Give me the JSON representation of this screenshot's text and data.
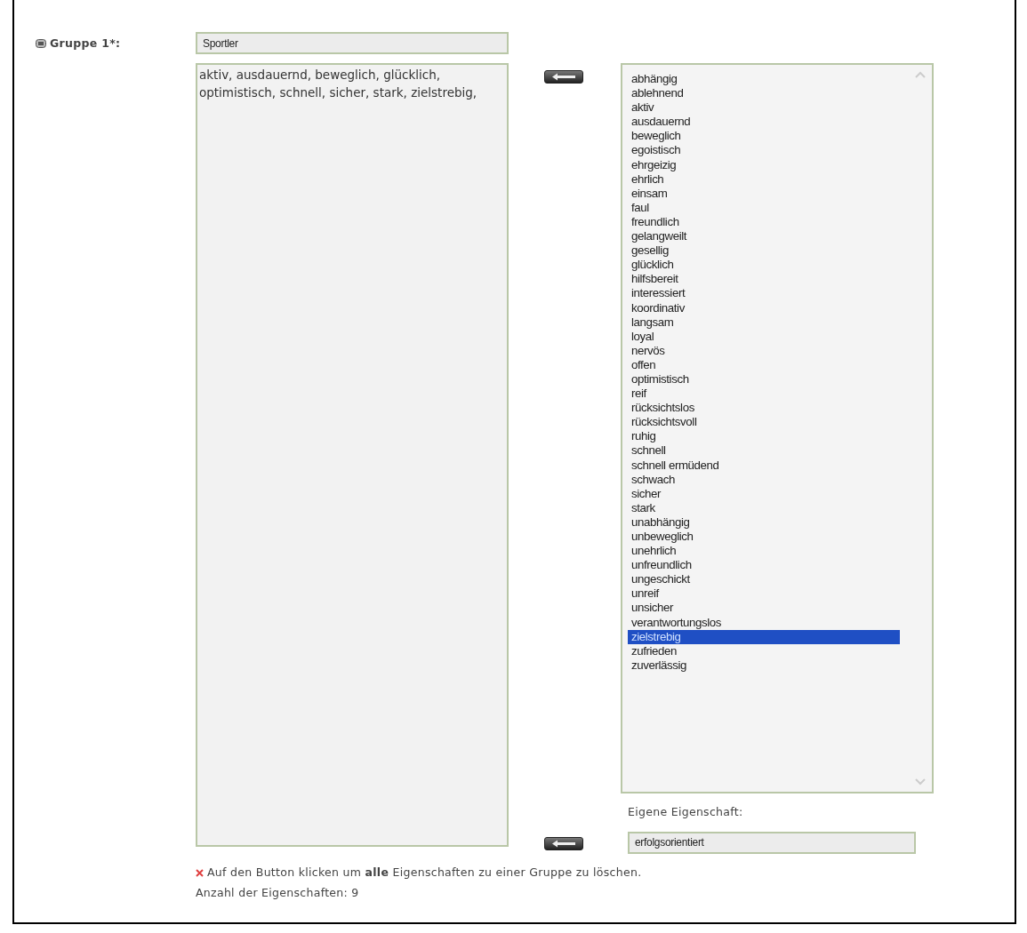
{
  "group": {
    "label": "Gruppe 1*:",
    "name_value": "Sportler",
    "traits_value": "aktiv, ausdauernd, beweglich, glücklich, optimistisch, schnell, sicher, stark, zielstrebig,"
  },
  "traits_list": [
    {
      "label": "abhängig",
      "selected": false
    },
    {
      "label": "ablehnend",
      "selected": false
    },
    {
      "label": "aktiv",
      "selected": false
    },
    {
      "label": "ausdauernd",
      "selected": false
    },
    {
      "label": "beweglich",
      "selected": false
    },
    {
      "label": "egoistisch",
      "selected": false
    },
    {
      "label": "ehrgeizig",
      "selected": false
    },
    {
      "label": "ehrlich",
      "selected": false
    },
    {
      "label": "einsam",
      "selected": false
    },
    {
      "label": "faul",
      "selected": false
    },
    {
      "label": "freundlich",
      "selected": false
    },
    {
      "label": "gelangweilt",
      "selected": false
    },
    {
      "label": "gesellig",
      "selected": false
    },
    {
      "label": "glücklich",
      "selected": false
    },
    {
      "label": "hilfsbereit",
      "selected": false
    },
    {
      "label": "interessiert",
      "selected": false
    },
    {
      "label": "koordinativ",
      "selected": false
    },
    {
      "label": "langsam",
      "selected": false
    },
    {
      "label": "loyal",
      "selected": false
    },
    {
      "label": "nervös",
      "selected": false
    },
    {
      "label": "offen",
      "selected": false
    },
    {
      "label": "optimistisch",
      "selected": false
    },
    {
      "label": "reif",
      "selected": false
    },
    {
      "label": "rücksichtslos",
      "selected": false
    },
    {
      "label": "rücksichtsvoll",
      "selected": false
    },
    {
      "label": "ruhig",
      "selected": false
    },
    {
      "label": "schnell",
      "selected": false
    },
    {
      "label": "schnell ermüdend",
      "selected": false
    },
    {
      "label": "schwach",
      "selected": false
    },
    {
      "label": "sicher",
      "selected": false
    },
    {
      "label": "stark",
      "selected": false
    },
    {
      "label": "unabhängig",
      "selected": false
    },
    {
      "label": "unbeweglich",
      "selected": false
    },
    {
      "label": "unehrlich",
      "selected": false
    },
    {
      "label": "unfreundlich",
      "selected": false
    },
    {
      "label": "ungeschickt",
      "selected": false
    },
    {
      "label": "unreif",
      "selected": false
    },
    {
      "label": "unsicher",
      "selected": false
    },
    {
      "label": "verantwortungslos",
      "selected": false
    },
    {
      "label": "zielstrebig",
      "selected": true
    },
    {
      "label": "zufrieden",
      "selected": false
    },
    {
      "label": "zuverlässig",
      "selected": false
    }
  ],
  "custom_trait": {
    "label": "Eigene Eigenschaft:",
    "value": "erfolgsorientiert"
  },
  "note": "Auf den Button klicken um **alle** Eigenschaften zu einer Gruppe zu löschen.",
  "count": "Anzahl der Eigenschaften: 9"
}
